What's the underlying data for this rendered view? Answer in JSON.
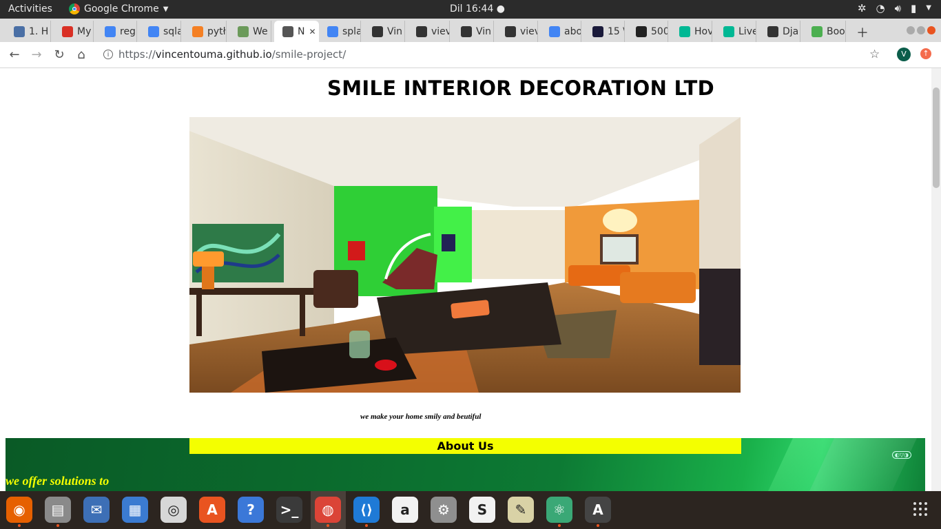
{
  "system_bar": {
    "activities": "Activities",
    "app_name": "Google Chrome",
    "clock": "Dil 16:44 ●"
  },
  "tabs": [
    {
      "label": "1. H",
      "icon": "list-icon",
      "color": "#4a6fa5"
    },
    {
      "label": "My",
      "icon": "gmail-icon",
      "color": "#d93025"
    },
    {
      "label": "reg",
      "icon": "google-icon",
      "color": "#4285f4"
    },
    {
      "label": "sqla",
      "icon": "google-icon",
      "color": "#4285f4"
    },
    {
      "label": "pytł",
      "icon": "stackoverflow-icon",
      "color": "#f48024"
    },
    {
      "label": "We",
      "icon": "arrow-icon",
      "color": "#6b9a5a"
    },
    {
      "label": "N",
      "icon": "globe-icon",
      "color": "#555555",
      "active": true
    },
    {
      "label": "spla",
      "icon": "google-icon",
      "color": "#4285f4"
    },
    {
      "label": "Vin",
      "icon": "github-icon",
      "color": "#333333"
    },
    {
      "label": "viev",
      "icon": "github-icon",
      "color": "#333333"
    },
    {
      "label": "Vin",
      "icon": "github-icon",
      "color": "#333333"
    },
    {
      "label": "viev",
      "icon": "github-icon",
      "color": "#333333"
    },
    {
      "label": "abo",
      "icon": "google-icon",
      "color": "#4285f4"
    },
    {
      "label": "15 \\",
      "icon": "arch-icon",
      "color": "#1a1a3a"
    },
    {
      "label": "500",
      "icon": "site-icon",
      "color": "#222222"
    },
    {
      "label": "Hov",
      "icon": "hexagon-icon",
      "color": "#00b894"
    },
    {
      "label": "Live",
      "icon": "hexagon-icon",
      "color": "#00b894"
    },
    {
      "label": "Dja",
      "icon": "github-icon",
      "color": "#333333"
    },
    {
      "label": "Boo",
      "icon": "chart-icon",
      "color": "#4caf50"
    }
  ],
  "address_bar": {
    "scheme": "https://",
    "host": "vincentouma.github.io",
    "path": "/smile-project/",
    "avatar_letter": "V"
  },
  "page": {
    "title": "SMILE INTERIOR DECORATION LTD",
    "tagline": "we make your home smily and beutiful",
    "about_heading": "About Us",
    "offer_text": "we offer solutions to",
    "watermark": "◐▽◑"
  },
  "dock": [
    {
      "name": "firefox",
      "color": "#e66000",
      "glyph": "◉",
      "running": true
    },
    {
      "name": "files",
      "color": "#8a8a8a",
      "glyph": "▤",
      "running": true
    },
    {
      "name": "thunderbird",
      "color": "#3d6fb6",
      "glyph": "✉",
      "running": false
    },
    {
      "name": "writer",
      "color": "#3b7bd1",
      "glyph": "▦",
      "running": false
    },
    {
      "name": "rhythmbox",
      "color": "#d7d7d7",
      "glyph": "◎",
      "running": false
    },
    {
      "name": "software",
      "color": "#e95420",
      "glyph": "A",
      "running": false
    },
    {
      "name": "help",
      "color": "#3b78d8",
      "glyph": "?",
      "running": false
    },
    {
      "name": "terminal",
      "color": "#3a3a3a",
      "glyph": ">_",
      "running": false
    },
    {
      "name": "chrome",
      "color": "#db4437",
      "glyph": "◍",
      "running": true
    },
    {
      "name": "vscode",
      "color": "#1f7ad6",
      "glyph": "⟨⟩",
      "running": true
    },
    {
      "name": "amazon",
      "color": "#f2f2f2",
      "glyph": "a",
      "running": false
    },
    {
      "name": "settings",
      "color": "#8f8f8f",
      "glyph": "⚙",
      "running": false
    },
    {
      "name": "slack",
      "color": "#f2f2f2",
      "glyph": "S",
      "running": false
    },
    {
      "name": "image-viewer",
      "color": "#d9d2a6",
      "glyph": "✎",
      "running": false
    },
    {
      "name": "atom",
      "color": "#3aa876",
      "glyph": "⚛",
      "running": true
    },
    {
      "name": "updater",
      "color": "#444444",
      "glyph": "A",
      "running": true
    }
  ]
}
